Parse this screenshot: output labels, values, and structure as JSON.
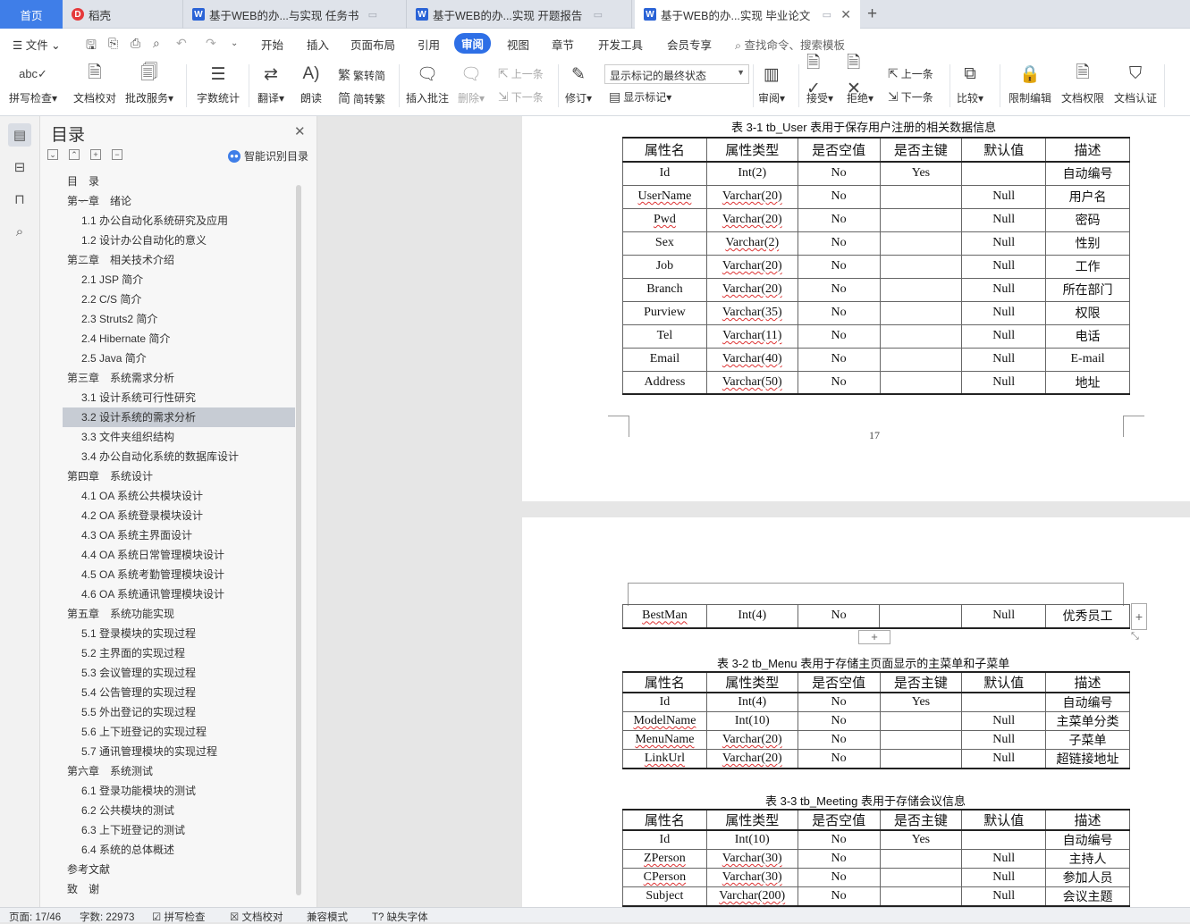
{
  "tabs": [
    {
      "label": "首页"
    },
    {
      "label": "稻壳"
    },
    {
      "label": "基于WEB的办...与实现 任务书"
    },
    {
      "label": "基于WEB的办...实现 开题报告"
    },
    {
      "label": "基于WEB的办...实现 毕业论文"
    }
  ],
  "menu": {
    "file": "文件",
    "items": [
      "开始",
      "插入",
      "页面布局",
      "引用",
      "审阅",
      "视图",
      "章节",
      "开发工具",
      "会员专享"
    ],
    "search": "查找命令、搜索模板"
  },
  "ribbon": {
    "spell": "拼写检查",
    "proof": "文档校对",
    "batch": "批改服务",
    "wordcount": "字数统计",
    "translate": "翻译",
    "read": "朗读",
    "t2s": "繁转简",
    "s2t": "简转繁",
    "insert_comment": "插入批注",
    "delete": "删除",
    "prev": "上一条",
    "next": "下一条",
    "track": "修订",
    "markup_state": "显示标记的最终状态",
    "show_markup": "显示标记",
    "review": "审阅",
    "accept": "接受",
    "reject": "拒绝",
    "prev2": "上一条",
    "next2": "下一条",
    "compare": "比较",
    "restrict": "限制编辑",
    "permission": "文档权限",
    "certify": "文档认证"
  },
  "toc": {
    "title": "目录",
    "smart": "智能识别目录",
    "items": [
      {
        "text": "目　录",
        "level": 0
      },
      {
        "text": "第一章　绪论",
        "level": 1
      },
      {
        "text": "1.1  办公自动化系统研究及应用",
        "level": 2
      },
      {
        "text": "1.2  设计办公自动化的意义",
        "level": 2
      },
      {
        "text": "第二章　相关技术介绍",
        "level": 1
      },
      {
        "text": "2.1 JSP 简介",
        "level": 2
      },
      {
        "text": "2.2 C/S 简介",
        "level": 2
      },
      {
        "text": "2.3 Struts2 简介",
        "level": 2
      },
      {
        "text": "2.4 Hibernate 简介",
        "level": 2
      },
      {
        "text": "2.5 Java 简介",
        "level": 2
      },
      {
        "text": "第三章　系统需求分析",
        "level": 1
      },
      {
        "text": "3.1  设计系统可行性研究",
        "level": 2
      },
      {
        "text": "3.2  设计系统的需求分析",
        "level": 2,
        "selected": true
      },
      {
        "text": "3.3  文件夹组织结构",
        "level": 2
      },
      {
        "text": "3.4  办公自动化系统的数据库设计",
        "level": 2
      },
      {
        "text": "第四章　系统设计",
        "level": 1
      },
      {
        "text": "4.1 OA 系统公共模块设计",
        "level": 2
      },
      {
        "text": "4.2 OA 系统登录模块设计",
        "level": 2
      },
      {
        "text": "4.3 OA 系统主界面设计",
        "level": 2
      },
      {
        "text": "4.4 OA 系统日常管理模块设计",
        "level": 2
      },
      {
        "text": "4.5 OA 系统考勤管理模块设计",
        "level": 2
      },
      {
        "text": "4.6 OA 系统通讯管理模块设计",
        "level": 2
      },
      {
        "text": "第五章　系统功能实现",
        "level": 1
      },
      {
        "text": "5.1  登录模块的实现过程",
        "level": 2
      },
      {
        "text": "5.2  主界面的实现过程",
        "level": 2
      },
      {
        "text": "5.3  会议管理的实现过程",
        "level": 2
      },
      {
        "text": "5.4  公告管理的实现过程",
        "level": 2
      },
      {
        "text": "5.5  外出登记的实现过程",
        "level": 2
      },
      {
        "text": "5.6  上下班登记的实现过程",
        "level": 2
      },
      {
        "text": "5.7  通讯管理模块的实现过程",
        "level": 2
      },
      {
        "text": "第六章　系统测试",
        "level": 1
      },
      {
        "text": "6.1  登录功能模块的测试",
        "level": 2
      },
      {
        "text": "6.2  公共模块的测试",
        "level": 2
      },
      {
        "text": "6.3  上下班登记的测试",
        "level": 2
      },
      {
        "text": "6.4  系统的总体概述",
        "level": 2
      },
      {
        "text": "参考文献",
        "level": 0
      },
      {
        "text": "致　谢",
        "level": 0
      }
    ]
  },
  "doc": {
    "headers": [
      "属性名",
      "属性类型",
      "是否空值",
      "是否主键",
      "默认值",
      "描述"
    ],
    "table1": {
      "caption": "表 3-1    tb_User 表用于保存用户注册的相关数据信息",
      "rows": [
        [
          "Id",
          "Int(2)",
          "No",
          "Yes",
          "",
          "自动编号"
        ],
        [
          "UserName",
          "Varchar(20)",
          "No",
          "",
          "Null",
          "用户名"
        ],
        [
          "Pwd",
          "Varchar(20)",
          "No",
          "",
          "Null",
          "密码"
        ],
        [
          "Sex",
          "Varchar(2)",
          "No",
          "",
          "Null",
          "性别"
        ],
        [
          "Job",
          "Varchar(20)",
          "No",
          "",
          "Null",
          "工作"
        ],
        [
          "Branch",
          "Varchar(20)",
          "No",
          "",
          "Null",
          "所在部门"
        ],
        [
          "Purview",
          "Varchar(35)",
          "No",
          "",
          "Null",
          "权限"
        ],
        [
          "Tel",
          "Varchar(11)",
          "No",
          "",
          "Null",
          "电话"
        ],
        [
          "Email",
          "Varchar(40)",
          "No",
          "",
          "Null",
          "E-mail"
        ],
        [
          "Address",
          "Varchar(50)",
          "No",
          "",
          "Null",
          "地址"
        ]
      ]
    },
    "page_number": "17",
    "cont_row": [
      "BestMan",
      "Int(4)",
      "No",
      "",
      "Null",
      "优秀员工"
    ],
    "table2": {
      "caption": "表 3-2    tb_Menu 表用于存储主页面显示的主菜单和子菜单",
      "rows": [
        [
          "Id",
          "Int(4)",
          "No",
          "Yes",
          "",
          "自动编号"
        ],
        [
          "ModelName",
          "Int(10)",
          "No",
          "",
          "Null",
          "主菜单分类"
        ],
        [
          "MenuName",
          "Varchar(20)",
          "No",
          "",
          "Null",
          "子菜单"
        ],
        [
          "LinkUrl",
          "Varchar(20)",
          "No",
          "",
          "Null",
          "超链接地址"
        ]
      ]
    },
    "table3": {
      "caption": "表 3-3    tb_Meeting  表用于存储会议信息",
      "rows": [
        [
          "Id",
          "Int(10)",
          "No",
          "Yes",
          "",
          "自动编号"
        ],
        [
          "ZPerson",
          "Varchar(30)",
          "No",
          "",
          "Null",
          "主持人"
        ],
        [
          "CPerson",
          "Varchar(30)",
          "No",
          "",
          "Null",
          "参加人员"
        ],
        [
          "Subject",
          "Varchar(200)",
          "No",
          "",
          "Null",
          "会议主题"
        ]
      ]
    }
  },
  "status": {
    "page": "页面: 17/46",
    "words": "字数: 22973",
    "spell": "拼写检查",
    "proof": "文档校对",
    "compat": "兼容模式",
    "missing_font": "缺失字体"
  }
}
